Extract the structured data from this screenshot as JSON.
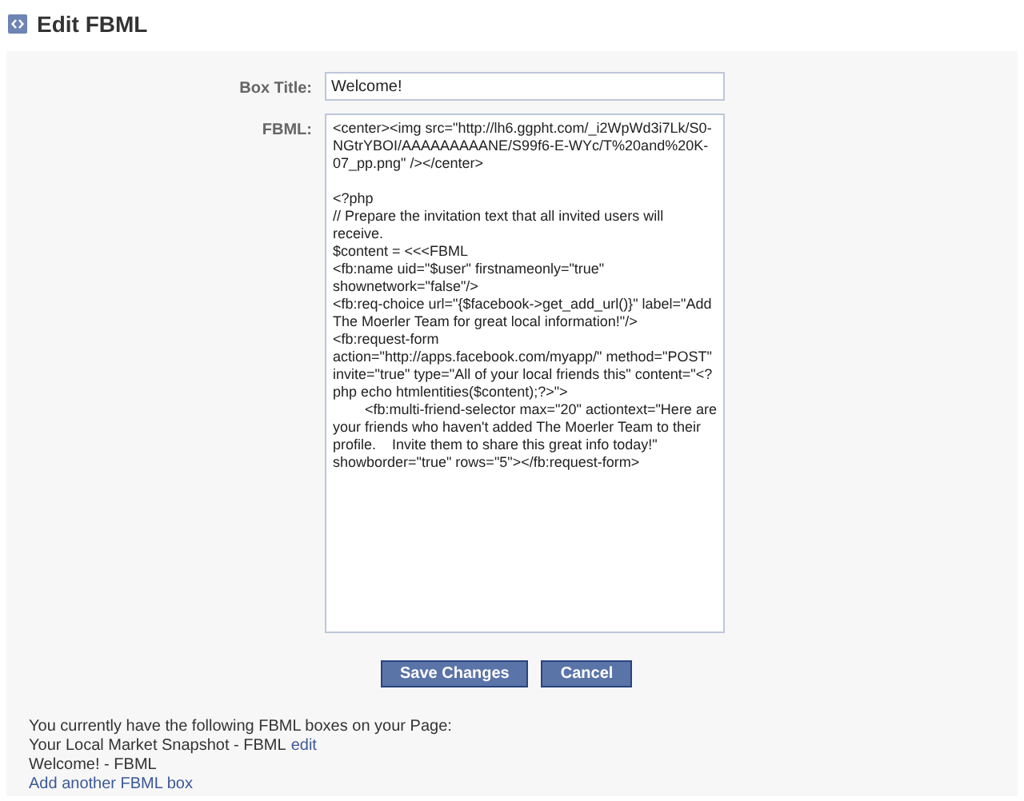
{
  "header": {
    "title": "Edit FBML"
  },
  "form": {
    "fields": [
      {
        "label": "Box Title:",
        "kind": "input",
        "value": "Welcome!"
      },
      {
        "label": "FBML:",
        "kind": "textarea",
        "value": "<center><img src=\"http://lh6.ggpht.com/_i2WpWd3i7Lk/S0-NGtrYBOI/AAAAAAAAANE/S99f6-E-WYc/T%20and%20K-07_pp.png\" /></center>\n\n<?php\n// Prepare the invitation text that all invited users will receive.\n$content = <<<FBML\n<fb:name uid=\"$user\" firstnameonly=\"true\" shownetwork=\"false\"/>\n<fb:req-choice url=\"{$facebook->get_add_url()}\" label=\"Add The Moerler Team for great local information!\"/>\n<fb:request-form\naction=\"http://apps.facebook.com/myapp/\" method=\"POST\" invite=\"true\" type=\"All of your local friends this\" content=\"<?php echo htmlentities($content);?>\">\n        <fb:multi-friend-selector max=\"20\" actiontext=\"Here are your friends who haven't added The Moerler Team to their profile.    Invite them to share this great info today!\" showborder=\"true\" rows=\"5\"></fb:request-form>"
      }
    ],
    "buttons": [
      "Save Changes",
      "Cancel"
    ]
  },
  "boxes": {
    "intro": "You currently have the following FBML boxes on your Page:",
    "items": [
      {
        "text": "Your Local Market Snapshot - FBML",
        "link": "edit"
      },
      {
        "text": "Welcome! - FBML"
      }
    ],
    "add_link": "Add another FBML box"
  }
}
